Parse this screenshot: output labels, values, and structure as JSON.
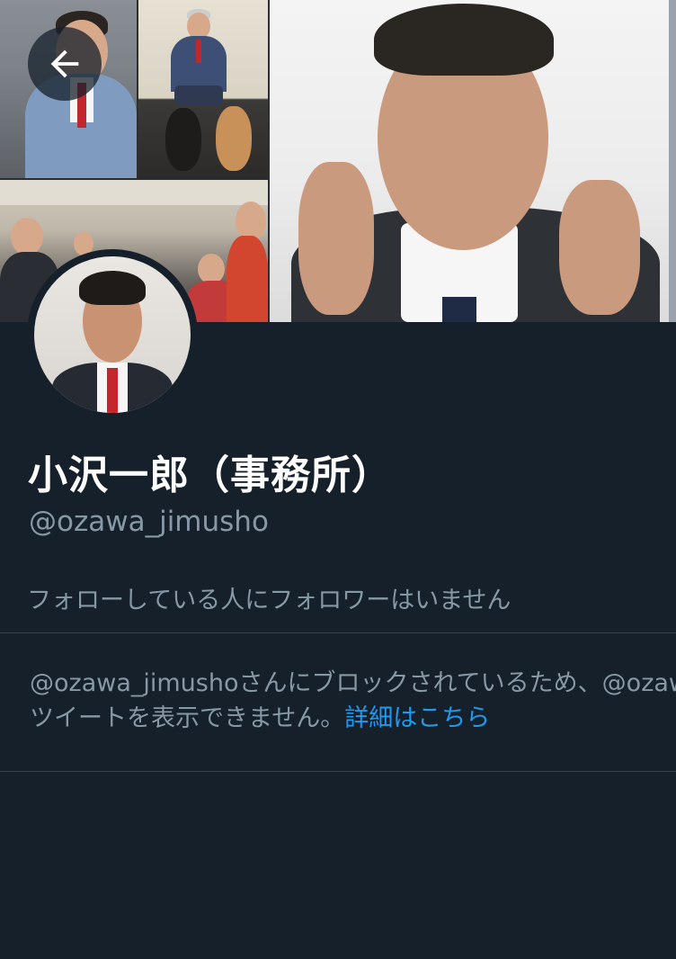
{
  "profile": {
    "display_name": "小沢一郎（事務所）",
    "handle": "@ozawa_jimusho",
    "follow_info": "フォローしている人にフォロワーはいません"
  },
  "blocked_notice": {
    "line1": "@ozawa_jimushoさんにブロックされているため、@ozawa_jimushoさんの",
    "line2_text": "ツイートを表示できません。",
    "learn_more": "詳細はこちら"
  },
  "colors": {
    "background": "#15202b",
    "primary_text": "#ffffff",
    "secondary_text": "#8899a6",
    "link": "#1d9bf0",
    "divider": "#38444d"
  },
  "icons": {
    "back": "arrow-left-icon"
  }
}
